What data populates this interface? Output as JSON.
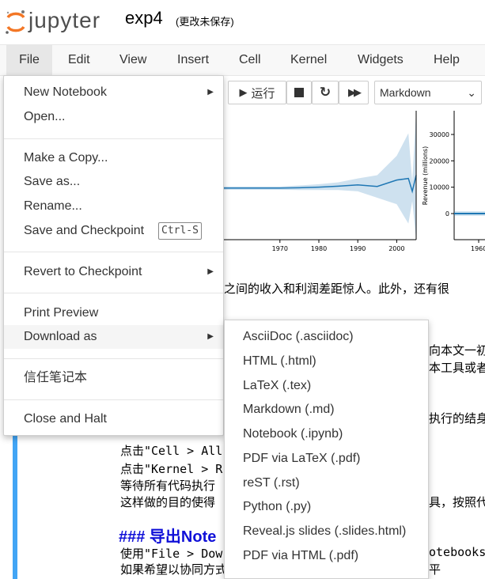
{
  "header": {
    "logo_text": "jupyter",
    "notebook_name": "exp4",
    "save_status": "(更改未保存)"
  },
  "menubar": [
    "File",
    "Edit",
    "View",
    "Insert",
    "Cell",
    "Kernel",
    "Widgets",
    "Help"
  ],
  "toolbar": {
    "run_label": "运行",
    "cell_type": "Markdown"
  },
  "file_menu": {
    "new_notebook": "New Notebook",
    "open": "Open...",
    "make_copy": "Make a Copy...",
    "save_as": "Save as...",
    "rename": "Rename...",
    "save_checkpoint": "Save and Checkpoint",
    "save_shortcut": "Ctrl-S",
    "revert": "Revert to Checkpoint",
    "print_preview": "Print Preview",
    "download_as": "Download as",
    "trust": "信任笔记本",
    "close_halt": "Close and Halt"
  },
  "download_menu": [
    "AsciiDoc (.asciidoc)",
    "HTML (.html)",
    "LaTeX (.tex)",
    "Markdown (.md)",
    "Notebook (.ipynb)",
    "PDF via LaTeX (.pdf)",
    "reST (.rst)",
    "Python (.py)",
    "Reveal.js slides (.slides.html)",
    "PDF via HTML (.pdf)"
  ],
  "notebook_text": {
    "line1": "之间的收入和利润差距惊人。此外，还有很",
    "line2": "向本文一初",
    "line3": "本工具或者",
    "line4": "执行的结身",
    "line5": "点击\"Cell > All",
    "line6": "点击\"Kernel > R",
    "line7": "等待所有代码执行",
    "line8": "这样做的目的使得",
    "line8b": "具，按照代",
    "heading": "### 导出Note",
    "line9": "使用\"File > Dow",
    "line9b": "otebooks.",
    "line10": "如果希望以协同方式与其他人分享，请考虑使用相关的在线平"
  },
  "chart_data": [
    {
      "type": "line",
      "x": [
        1955,
        1960,
        1965,
        1970,
        1975,
        1980,
        1985,
        1990,
        1995,
        2000,
        2003,
        2004,
        2005
      ],
      "series": [
        {
          "values": [
            16000,
            16000,
            16000,
            16000,
            16100,
            16300,
            16600,
            17000,
            16500,
            18500,
            19000,
            15000,
            20000
          ]
        }
      ],
      "band_upper": [
        16500,
        16500,
        16500,
        16500,
        16800,
        17200,
        17800,
        19000,
        20000,
        26000,
        33000,
        18000,
        40000
      ],
      "band_lower": [
        15500,
        15500,
        15500,
        15500,
        15400,
        15400,
        15400,
        15000,
        13000,
        11000,
        5000,
        12000,
        0
      ],
      "x_ticks": [
        "1970",
        "1980",
        "1990",
        "2000"
      ],
      "color": "#1f77b4"
    },
    {
      "type": "line",
      "ylabel": "Revenue (millions)",
      "y_ticks": [
        "0",
        "10000",
        "20000",
        "30000"
      ],
      "x_ticks": [
        "1960"
      ],
      "series": [
        {
          "values": [
            0,
            0
          ]
        }
      ],
      "color": "#1f77b4"
    }
  ]
}
